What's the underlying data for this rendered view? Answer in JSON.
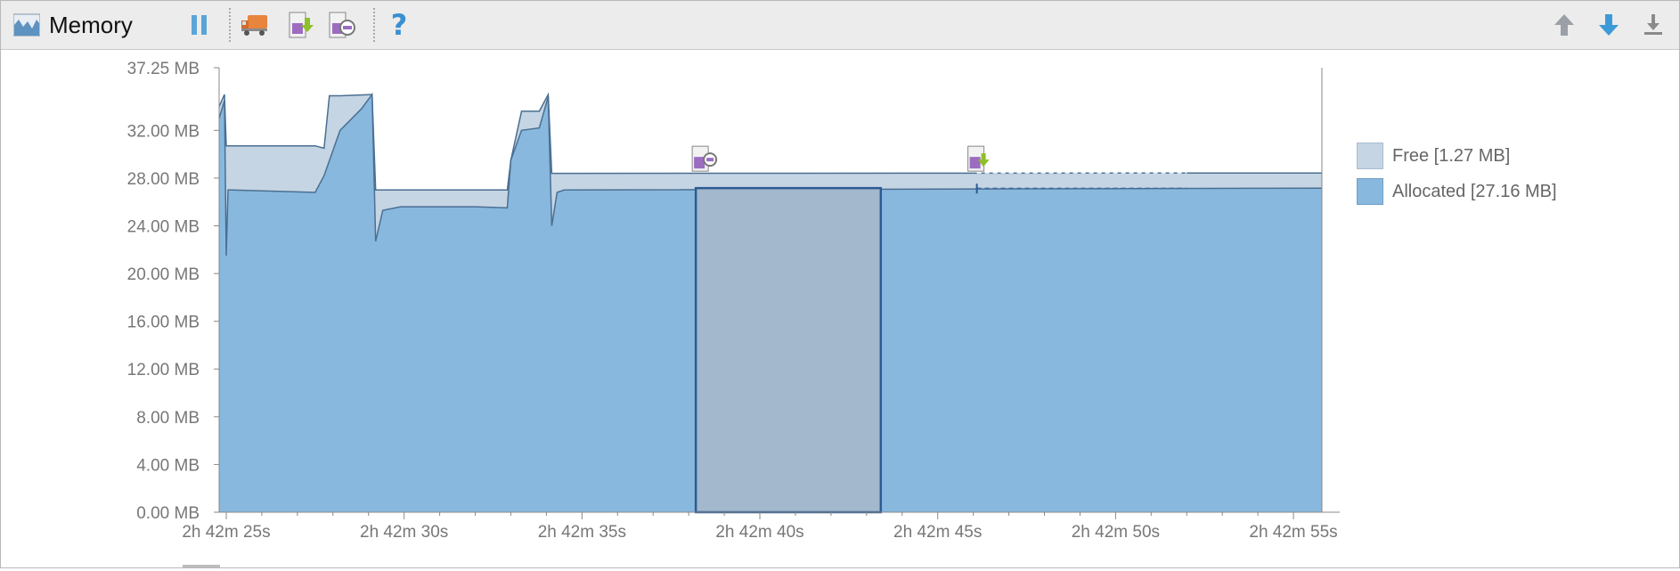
{
  "toolbar": {
    "title": "Memory",
    "title_icon": "memory-chart-icon",
    "buttons": [
      {
        "name": "pause-button",
        "icon": "pause-icon"
      },
      {
        "name": "gc-button",
        "icon": "garbage-truck-icon"
      },
      {
        "name": "dump-heap-button",
        "icon": "dump-java-heap-icon"
      },
      {
        "name": "allocation-tracking-button",
        "icon": "allocation-tracking-icon"
      },
      {
        "name": "help-button",
        "icon": "question-icon",
        "label": "?"
      }
    ],
    "right_buttons": [
      {
        "name": "scroll-up-button",
        "icon": "arrow-up-icon"
      },
      {
        "name": "scroll-down-button",
        "icon": "arrow-down-icon"
      },
      {
        "name": "export-button",
        "icon": "download-icon"
      }
    ]
  },
  "legend": [
    {
      "label": "Free [1.27 MB]",
      "color": "#c5d5e4"
    },
    {
      "label": "Allocated [27.16 MB]",
      "color": "#89b8de"
    }
  ],
  "colors": {
    "allocated_fill": "#89b8de",
    "free_fill": "#c5d5e4",
    "series_line": "#4a6f92",
    "selection_fill": "#a3b8cc",
    "selection_border": "#2c5b94"
  },
  "chart_data": {
    "type": "area",
    "ylim": [
      0,
      37.25
    ],
    "yticks": [
      "0.00 MB",
      "4.00 MB",
      "8.00 MB",
      "12.00 MB",
      "16.00 MB",
      "20.00 MB",
      "24.00 MB",
      "28.00 MB",
      "32.00 MB",
      "37.25 MB"
    ],
    "ytick_values": [
      0,
      4,
      8,
      12,
      16,
      20,
      24,
      28,
      32,
      37.25
    ],
    "xlim": [
      9744.8,
      9775.8
    ],
    "xticks": [
      "2h 42m 25s",
      "2h 42m 30s",
      "2h 42m 35s",
      "2h 42m 40s",
      "2h 42m 45s",
      "2h 42m 50s",
      "2h 42m 55s"
    ],
    "xtick_values": [
      9745,
      9750,
      9755,
      9760,
      9765,
      9770,
      9775
    ],
    "series": [
      {
        "name": "Allocated",
        "x": [
          9744.8,
          9744.95,
          9745.0,
          9745.05,
          9745.15,
          9747.5,
          9747.75,
          9748.2,
          9748.8,
          9749.1,
          9749.2,
          9749.4,
          9749.9,
          9750.0,
          9750.3,
          9750.5,
          9751.0,
          9752.0,
          9752.9,
          9753.0,
          9753.3,
          9753.8,
          9754.05,
          9754.15,
          9754.3,
          9754.5,
          9775.8
        ],
        "values": [
          33.0,
          34.5,
          21.5,
          27.0,
          27.0,
          26.8,
          28.2,
          32.0,
          33.8,
          35.0,
          22.7,
          25.3,
          25.6,
          25.6,
          25.6,
          25.6,
          25.6,
          25.6,
          25.5,
          29.5,
          32.0,
          32.2,
          34.8,
          24.0,
          26.8,
          27.0,
          27.16
        ]
      },
      {
        "name": "Free",
        "x": [
          9744.8,
          9744.95,
          9745.0,
          9745.15,
          9747.5,
          9747.75,
          9747.9,
          9748.2,
          9749.1,
          9749.2,
          9749.4,
          9752.9,
          9753.0,
          9753.3,
          9753.8,
          9754.05,
          9754.15,
          9754.3,
          9754.5,
          9775.8
        ],
        "values": [
          34.0,
          35.0,
          30.7,
          30.7,
          30.7,
          30.5,
          34.9,
          34.9,
          35.0,
          27.0,
          27.0,
          27.0,
          29.5,
          33.6,
          33.6,
          35.0,
          28.4,
          28.4,
          28.4,
          28.43
        ]
      }
    ],
    "selection": {
      "x_start": 9758.2,
      "x_end": 9763.4
    },
    "markers": [
      {
        "kind": "allocation-tracking",
        "x": 9758.35
      },
      {
        "kind": "heap-dump",
        "x": 9766.1
      }
    ]
  }
}
